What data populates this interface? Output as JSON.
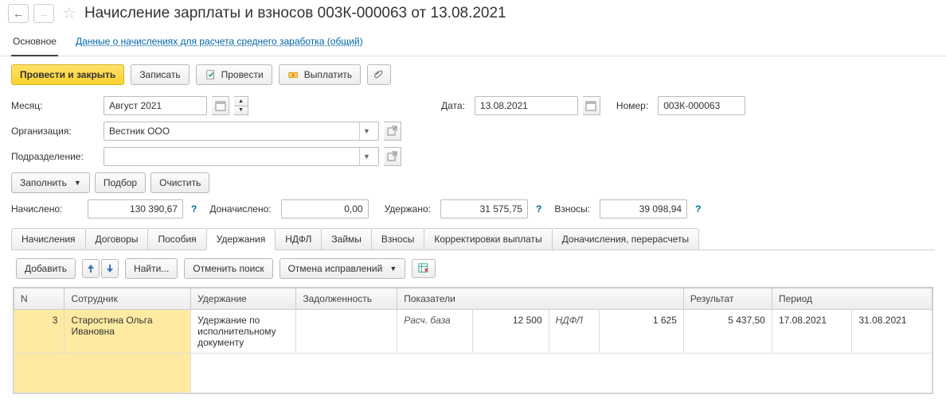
{
  "header": {
    "title": "Начисление зарплаты и взносов 003К-000063 от 13.08.2021"
  },
  "nav": {
    "main": "Основное",
    "link": "Данные о начислениях для расчета среднего заработка (общий)"
  },
  "toolbar": {
    "post_close": "Провести и закрыть",
    "save": "Записать",
    "post": "Провести",
    "pay": "Выплатить"
  },
  "form": {
    "month_label": "Месяц:",
    "month_value": "Август 2021",
    "date_label": "Дата:",
    "date_value": "13.08.2021",
    "number_label": "Номер:",
    "number_value": "003К-000063",
    "org_label": "Организация:",
    "org_value": "Вестник ООО",
    "dept_label": "Подразделение:",
    "dept_value": "",
    "fill": "Заполнить",
    "select": "Подбор",
    "clear": "Очистить",
    "accrued_label": "Начислено:",
    "accrued_value": "130 390,67",
    "add_accrued_label": "Доначислено:",
    "add_accrued_value": "0,00",
    "withheld_label": "Удержано:",
    "withheld_value": "31 575,75",
    "contrib_label": "Взносы:",
    "contrib_value": "39 098,94"
  },
  "tabs": {
    "accruals": "Начисления",
    "contracts": "Договоры",
    "benefits": "Пособия",
    "deductions": "Удержания",
    "ndfl": "НДФЛ",
    "loans": "Займы",
    "contrib": "Взносы",
    "corr": "Корректировки выплаты",
    "recalc": "Доначисления, перерасчеты"
  },
  "sub_toolbar": {
    "add": "Добавить",
    "find": "Найти...",
    "cancel_search": "Отменить поиск",
    "cancel_fix": "Отмена исправлений"
  },
  "table": {
    "headers": {
      "n": "N",
      "employee": "Сотрудник",
      "deduction": "Удержание",
      "debt": "Задолженность",
      "indicators": "Показатели",
      "result": "Результат",
      "period": "Период"
    },
    "rows": [
      {
        "n": "3",
        "employee": "Старостина Ольга Ивановна",
        "deduction": "Удержание по исполнительному документу",
        "debt": "",
        "ind_label1": "Расч. база",
        "ind_val1": "12 500",
        "ind_label2": "НДФЛ",
        "ind_val2": "1 625",
        "result": "5 437,50",
        "period_from": "17.08.2021",
        "period_to": "31.08.2021"
      }
    ]
  }
}
